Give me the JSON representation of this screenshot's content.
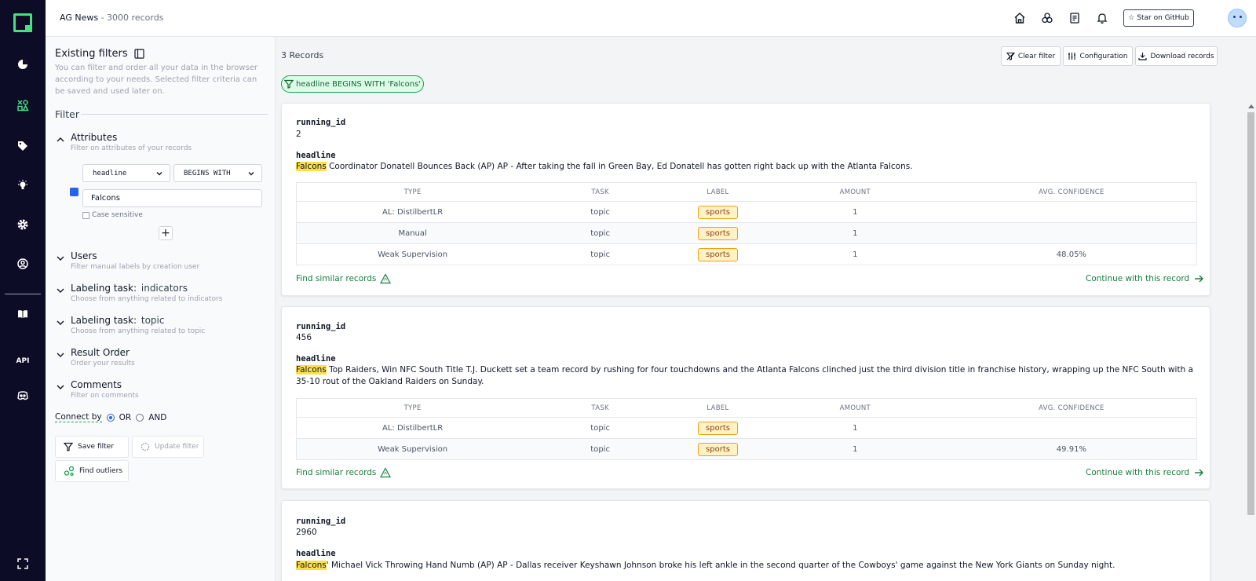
{
  "topbar": {
    "project_name": "AG News",
    "separator": " - ",
    "record_count": "3000 records",
    "star_button": "Star on GitHub"
  },
  "sidebar_rail": {
    "items": [
      "logo-icon",
      "overview-icon",
      "data-browser-icon",
      "labeling-icon",
      "heuristics-icon",
      "settings-icon",
      "admin-icon",
      "docs-icon",
      "api-icon",
      "discord-icon",
      "fullscreen-icon"
    ],
    "api_label": "API"
  },
  "filters": {
    "title": "Existing filters",
    "description": "You can filter and order all your data in the browser according to your needs. Selected filter criteria can be saved and used later on.",
    "filter_heading": "Filter",
    "attributes": {
      "name": "Attributes",
      "hint": "Filter on attributes of your records",
      "attribute_select": "headline",
      "operator_select": "BEGINS WITH",
      "value": "Falcons",
      "case_sensitive_label": "Case sensitive"
    },
    "users": {
      "name": "Users",
      "hint": "Filter manual labels by creation user"
    },
    "task_indicators": {
      "name": "Labeling task:",
      "task": "indicators",
      "hint": "Choose from anything related to indicators"
    },
    "task_topic": {
      "name": "Labeling task:",
      "task": "topic",
      "hint": "Choose from anything related to topic"
    },
    "result_order": {
      "name": "Result Order",
      "hint": "Order your results"
    },
    "comments": {
      "name": "Comments",
      "hint": "Filter on comments"
    },
    "connect_by": {
      "label": "Connect by",
      "or": "OR",
      "and": "AND",
      "selected": "OR"
    },
    "buttons": {
      "save": "Save filter",
      "update": "Update filter",
      "outliers": "Find outliers"
    }
  },
  "main": {
    "records_label": "3 Records",
    "toolbar": {
      "clear": "Clear filter",
      "config": "Configuration",
      "download": "Download records"
    },
    "active_filter_chip": "headline BEGINS WITH 'Falcons'",
    "table_headers": [
      "TYPE",
      "TASK",
      "LABEL",
      "AMOUNT",
      "AVG. CONFIDENCE"
    ],
    "find_similar": "Find similar records",
    "continue": "Continue with this record",
    "records": [
      {
        "id_label": "running_id",
        "id": "2",
        "headline_label": "headline",
        "headline_highlight": "Falcons",
        "headline_rest": " Coordinator Donatell Bounces Back (AP) AP - After taking the fall in Green Bay, Ed Donatell has gotten right back up with the Atlanta Falcons.",
        "rows": [
          [
            "AL: DistilbertLR",
            "topic",
            "sports",
            "1",
            ""
          ],
          [
            "Manual",
            "topic",
            "sports",
            "1",
            ""
          ],
          [
            "Weak Supervision",
            "topic",
            "sports",
            "1",
            "48.05%"
          ]
        ]
      },
      {
        "id_label": "running_id",
        "id": "456",
        "headline_label": "headline",
        "headline_highlight": "Falcons",
        "headline_rest": " Top Raiders, Win NFC South Title T.J. Duckett set a team record by rushing for four touchdowns and the Atlanta Falcons clinched just the third division title in franchise history, wrapping up the NFC South with a 35-10 rout of the Oakland Raiders on Sunday.",
        "rows": [
          [
            "AL: DistilbertLR",
            "topic",
            "sports",
            "1",
            ""
          ],
          [
            "Weak Supervision",
            "topic",
            "sports",
            "1",
            "49.91%"
          ]
        ]
      },
      {
        "id_label": "running_id",
        "id": "2960",
        "headline_label": "headline",
        "headline_highlight": "Falcons",
        "headline_rest": "' Michael Vick Throwing Hand Numb (AP) AP - Dallas receiver Keyshawn Johnson broke his left ankle in the second quarter of the Cowboys' game against the New York Giants on Sunday night."
      }
    ]
  },
  "colors": {
    "rail_bg": "#0c0c26",
    "accent_green": "#4ade80",
    "link_green": "#15803d",
    "highlight_yellow": "#fde047",
    "badge_amber": "#fef3c7"
  }
}
